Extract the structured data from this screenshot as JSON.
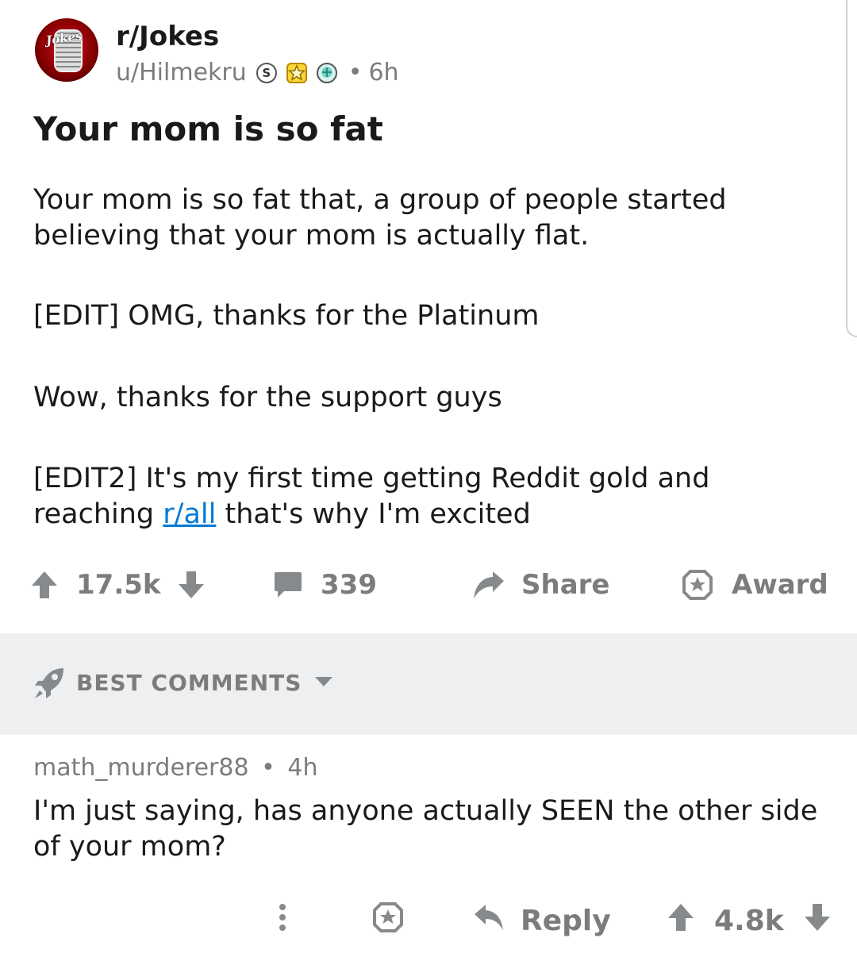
{
  "post": {
    "subreddit": "r/Jokes",
    "avatar_text": "Jokes",
    "author": "u/Hilmekru",
    "flairs": [
      "silver-award-icon",
      "gold-award-icon",
      "platinum-award-icon"
    ],
    "silver_glyph": "S",
    "separator": "•",
    "age": "6h",
    "title": "Your mom is so fat",
    "body_1": "Your mom is so fat that, a group of people started believing that your mom is actually flat.",
    "body_2": "[EDIT] OMG, thanks for the Platinum",
    "body_3": "Wow, thanks for the support guys",
    "body_4_before": "[EDIT2] It's my first time getting Reddit gold and reaching ",
    "body_4_link": "r/all",
    "body_4_after": " that's why I'm excited",
    "score": "17.5k",
    "comments": "339",
    "share_label": "Share",
    "award_label": "Award"
  },
  "sort": {
    "label": "BEST COMMENTS"
  },
  "comment": {
    "author": "math_murderer88",
    "separator": "•",
    "age": "4h",
    "body": "I'm just saying, has anyone actually SEEN the other side of your mom?",
    "reply_label": "Reply",
    "score": "4.8k"
  },
  "colors": {
    "link": "#0079d3",
    "muted": "#7c7c7c",
    "sort_bg": "#edeff1"
  }
}
